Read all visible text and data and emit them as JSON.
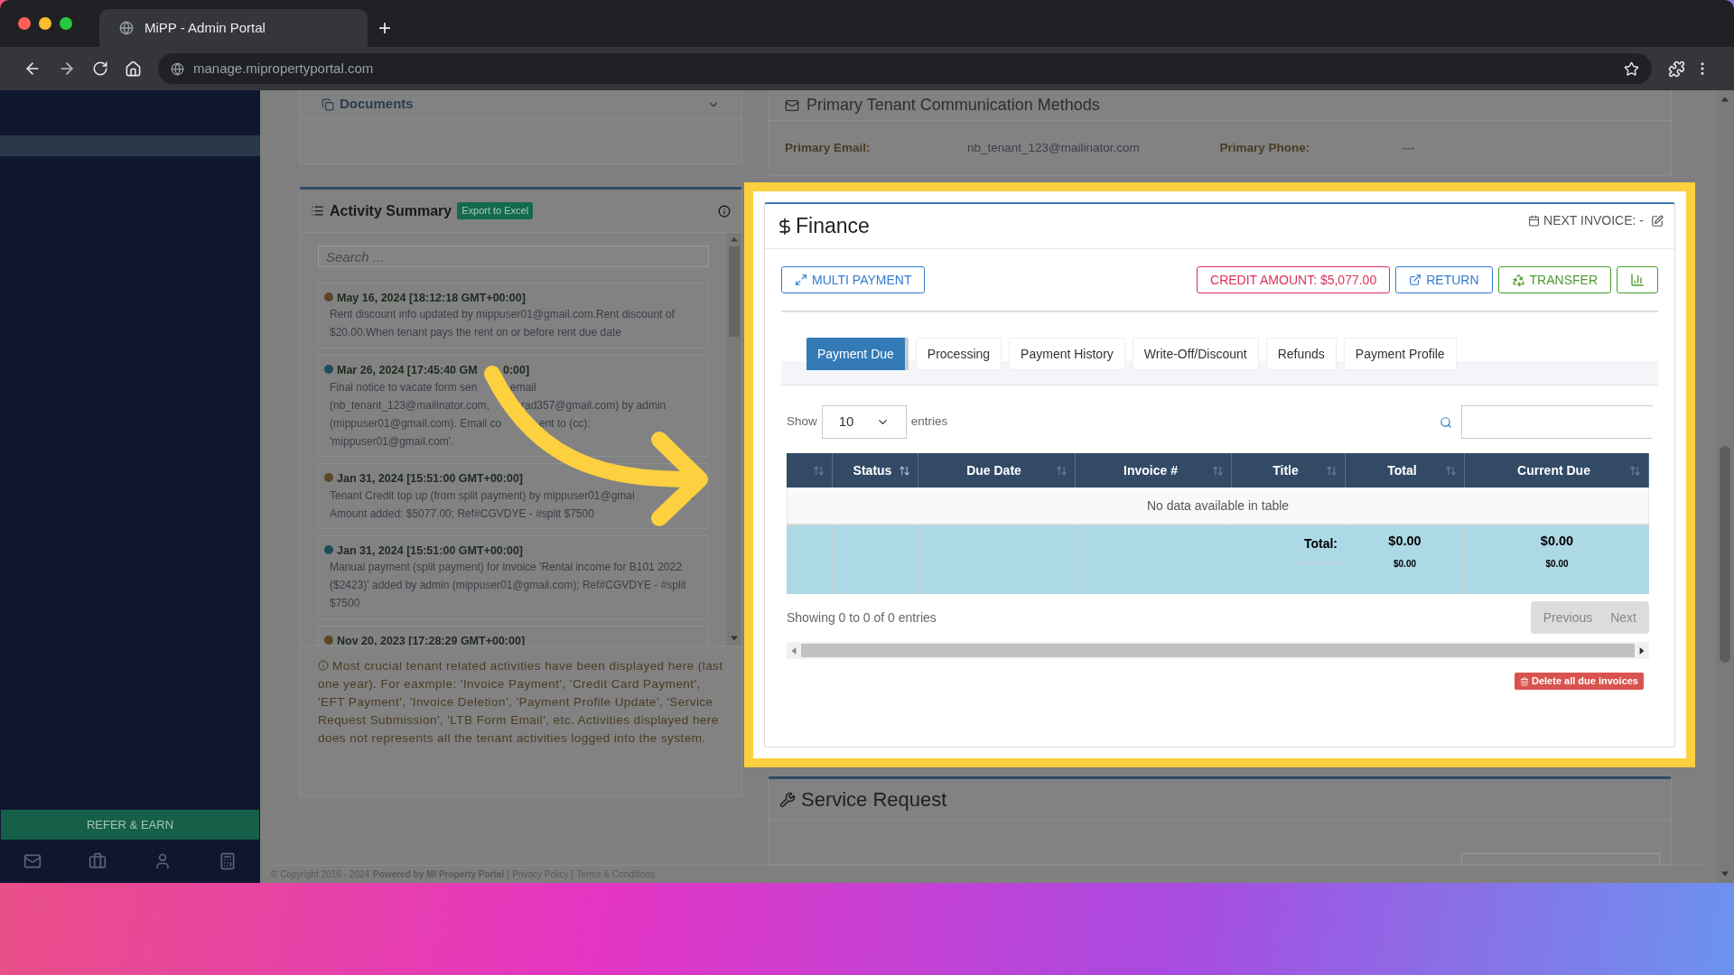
{
  "browser": {
    "tab_title": "MiPP - Admin Portal",
    "new_tab": "+",
    "url": "manage.mipropertyportal.com"
  },
  "sidebar": {
    "refer_button": "REFER & EARN"
  },
  "documents": {
    "title": "Documents"
  },
  "activity_summary": {
    "title": "Activity Summary",
    "export_button": "Export to Excel",
    "search_placeholder": "Search ...",
    "entries": [
      {
        "date": [
          "May 16, 2024 [18:12:18 GMT+00:00]"
        ],
        "text": "Rent discount info updated by mippuser01@gmail.com.Rent discount of $20.00.When tenant pays the rent on or before rent due date",
        "color": "#5c4626"
      },
      {
        "date": [
          "Mar 26, 2024 [17:45:40 GM",
          "0:00]"
        ],
        "lines": [
          [
            "Final notice to vacate form sen",
            "email"
          ],
          [
            "(nb_tenant_123@mailinator.com,",
            "rad357@gmail.com) by admin"
          ],
          [
            "(mippuser01@gmail.com). Email co",
            "ent to (cc):"
          ],
          [
            "'mippuser01@gmail.com'."
          ]
        ],
        "color": "#1f4b5a"
      },
      {
        "date": [
          "Jan 31, 2024 [15:51:00 GMT+00:00]"
        ],
        "lines": [
          [
            "Tenant Credit top up (from split payment) by mippuser01@gmai",
            "."
          ],
          [
            "Amount added: $5077.00; Ref#CGVDYE - #split $7500"
          ]
        ],
        "color": "#5c4626"
      },
      {
        "date": [
          "Jan 31, 2024 [15:51:00 GMT+00:00]"
        ],
        "text": "Manual payment (split payment) for invoice 'Rental income for B101 2022 ($2423)' added by admin (mippuser01@gmail.com); Ref#CGVDYE - #split $7500",
        "color": "#1f4b5a"
      },
      {
        "date": [
          "Nov 20, 2023 [17:28:29 GMT+00:00]"
        ],
        "color": "#5c4626"
      }
    ],
    "note": "Most crucial tenant related activities have been displayed here (last one year). For eaxmple: 'Invoice Payment', 'Credit Card Payment', 'EFT Payment', 'Invoice Deletion', 'Payment Profile Update', 'Service Request Submission', 'LTB Form Email', etc. Activities displayed here does not represents all the tenant activities logged into the system."
  },
  "primary_communication": {
    "title": "Primary Tenant Communication Methods",
    "fields": [
      {
        "label": "Primary Email:",
        "value": "nb_tenant_123@mailinator.com"
      },
      {
        "label": "Primary Phone:",
        "value": "---"
      }
    ]
  },
  "finance": {
    "title": "Finance",
    "next_invoice": "NEXT INVOICE: -",
    "buttons": [
      {
        "kind": "multi",
        "label": "MULTI PAYMENT"
      },
      {
        "kind": "credit",
        "label": "CREDIT AMOUNT: $5,077.00"
      },
      {
        "kind": "return",
        "label": "RETURN"
      },
      {
        "kind": "transfer",
        "label": "TRANSFER"
      },
      {
        "kind": "chart"
      }
    ],
    "tabs": [
      {
        "label": "Payment Due",
        "selected": true
      },
      {
        "label": "Processing",
        "selected": false
      },
      {
        "label": "Payment History",
        "selected": false
      },
      {
        "label": "Write-Off/Discount",
        "selected": false
      },
      {
        "label": "Refunds",
        "selected": false
      },
      {
        "label": "Payment Profile",
        "selected": false
      }
    ],
    "show_label": "Show",
    "entries_select": "10",
    "entries_label": "entries",
    "table": {
      "columns": [
        {
          "sorted": false
        },
        {
          "label": "Status",
          "sorted": true
        },
        {
          "label": "Due Date",
          "sorted": false
        },
        {
          "label": "Invoice #",
          "sorted": false
        },
        {
          "label": "Title",
          "sorted": false
        },
        {
          "label": "Total",
          "sorted": false
        },
        {
          "label": "Current Due",
          "sorted": false
        }
      ],
      "empty_message": "No data available in table",
      "total_label": "Total:",
      "totals": [
        {
          "main": "$0.00",
          "sub": "$0.00"
        },
        {
          "main": "$0.00",
          "sub": "$0.00"
        }
      ]
    },
    "info": "Showing 0 to 0 of 0 entries",
    "pagination": [
      {
        "label": "Previous",
        "disabled": true
      },
      {
        "label": "Next",
        "disabled": true
      }
    ],
    "delete_button": "Delete all due invoices"
  },
  "service_request": {
    "title": "Service Request"
  },
  "footer": {
    "copyright": "© Copyright 2016 - 2024",
    "powered": "Powered by MI Property Portal",
    "links": [
      "Privacy Policy",
      "Terms & Conditions"
    ]
  }
}
